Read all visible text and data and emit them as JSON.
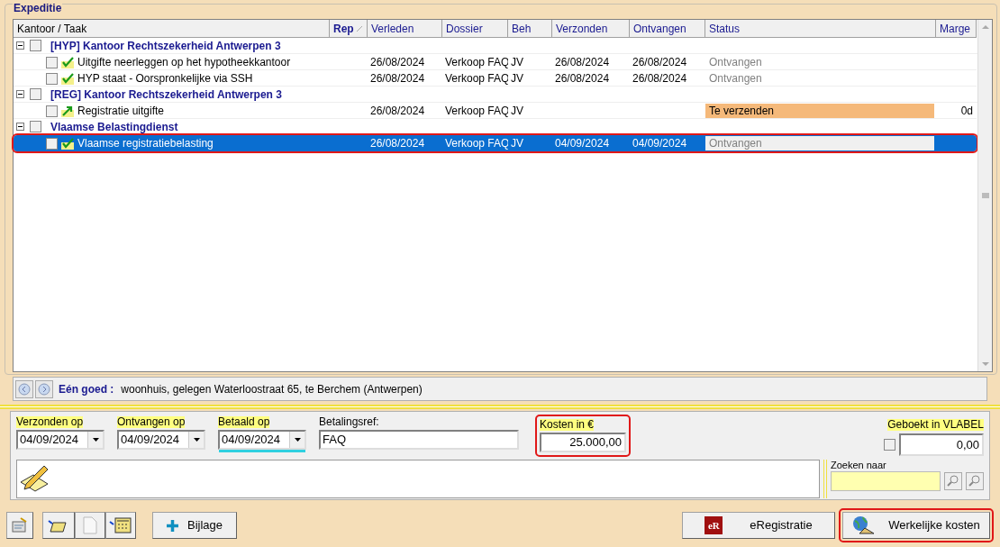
{
  "group_title": "Expeditie",
  "columns": [
    {
      "label": "Kantoor / Taak",
      "sorted": false
    },
    {
      "label": "Rep",
      "sorted": true
    },
    {
      "label": "Verleden",
      "sorted": false
    },
    {
      "label": "Dossier",
      "sorted": false
    },
    {
      "label": "Beh",
      "sorted": false
    },
    {
      "label": "Verzonden",
      "sorted": false
    },
    {
      "label": "Ontvangen",
      "sorted": false
    },
    {
      "label": "Status",
      "sorted": false
    },
    {
      "label": "Marge",
      "sorted": false
    }
  ],
  "rows": [
    {
      "kind": "group",
      "label": "[HYP] Kantoor Rechtszekerheid Antwerpen 3",
      "expanded": true,
      "checked": false
    },
    {
      "kind": "task",
      "done": true,
      "label": "Uitgifte neerleggen op het hypotheekkantoor",
      "checked": false,
      "selected": false,
      "highlighted": false,
      "verleden": "26/08/2024",
      "dossier": "Verkoop FAQ",
      "beh": "JV",
      "verzonden": "26/08/2024",
      "ontvangen": "26/08/2024",
      "status": "Ontvangen",
      "pending": false
    },
    {
      "kind": "task",
      "done": true,
      "label": "HYP staat - Oorspronkelijke via SSH",
      "checked": false,
      "selected": false,
      "highlighted": false,
      "verleden": "26/08/2024",
      "dossier": "Verkoop FAQ",
      "beh": "JV",
      "verzonden": "26/08/2024",
      "ontvangen": "26/08/2024",
      "status": "Ontvangen",
      "pending": false
    },
    {
      "kind": "group",
      "label": "[REG] Kantoor Rechtszekerheid Antwerpen 3",
      "expanded": true,
      "checked": false
    },
    {
      "kind": "task",
      "done": false,
      "label": "Registratie uitgifte",
      "checked": false,
      "selected": false,
      "highlighted": false,
      "verleden": "26/08/2024",
      "dossier": "Verkoop FAQ",
      "beh": "JV",
      "status": "Te verzenden",
      "pending": true,
      "marge": "0d"
    },
    {
      "kind": "group",
      "label": "Vlaamse Belastingdienst",
      "expanded": true,
      "checked": false
    },
    {
      "kind": "task",
      "done": true,
      "label": "Vlaamse registratiebelasting",
      "checked": false,
      "selected": true,
      "highlighted": true,
      "verleden": "26/08/2024",
      "dossier": "Verkoop FAQ",
      "beh": "JV",
      "verzonden": "04/09/2024",
      "ontvangen": "04/09/2024",
      "status": "Ontvangen",
      "pending": false
    }
  ],
  "info": {
    "label": "Eén goed :",
    "value": "woonhuis, gelegen Waterloostraat 65, te Berchem (Antwerpen)"
  },
  "form": {
    "verzonden_op": {
      "label": "Verzonden op",
      "value": "04/09/2024",
      "focused": false
    },
    "ontvangen_op": {
      "label": "Ontvangen op",
      "value": "04/09/2024",
      "focused": false
    },
    "betaald_op": {
      "label": "Betaald op",
      "value": "04/09/2024",
      "focused": true
    },
    "betalingsref": {
      "label": "Betalingsref:",
      "value": "FAQ"
    },
    "kosten": {
      "label": "Kosten in €",
      "value": "25.000,00",
      "highlighted": true
    },
    "geboekt": {
      "label": "Geboekt in VLABEL",
      "checked": false,
      "value": "0,00"
    },
    "zoeken": {
      "label": "Zoeken naar"
    }
  },
  "buttons": {
    "bijlage": "Bijlage",
    "eregistratie": {
      "icon_text": "eR",
      "label": "eRegistratie"
    },
    "werkelijke_kosten": {
      "label": "Werkelijke kosten",
      "highlighted": true
    }
  }
}
